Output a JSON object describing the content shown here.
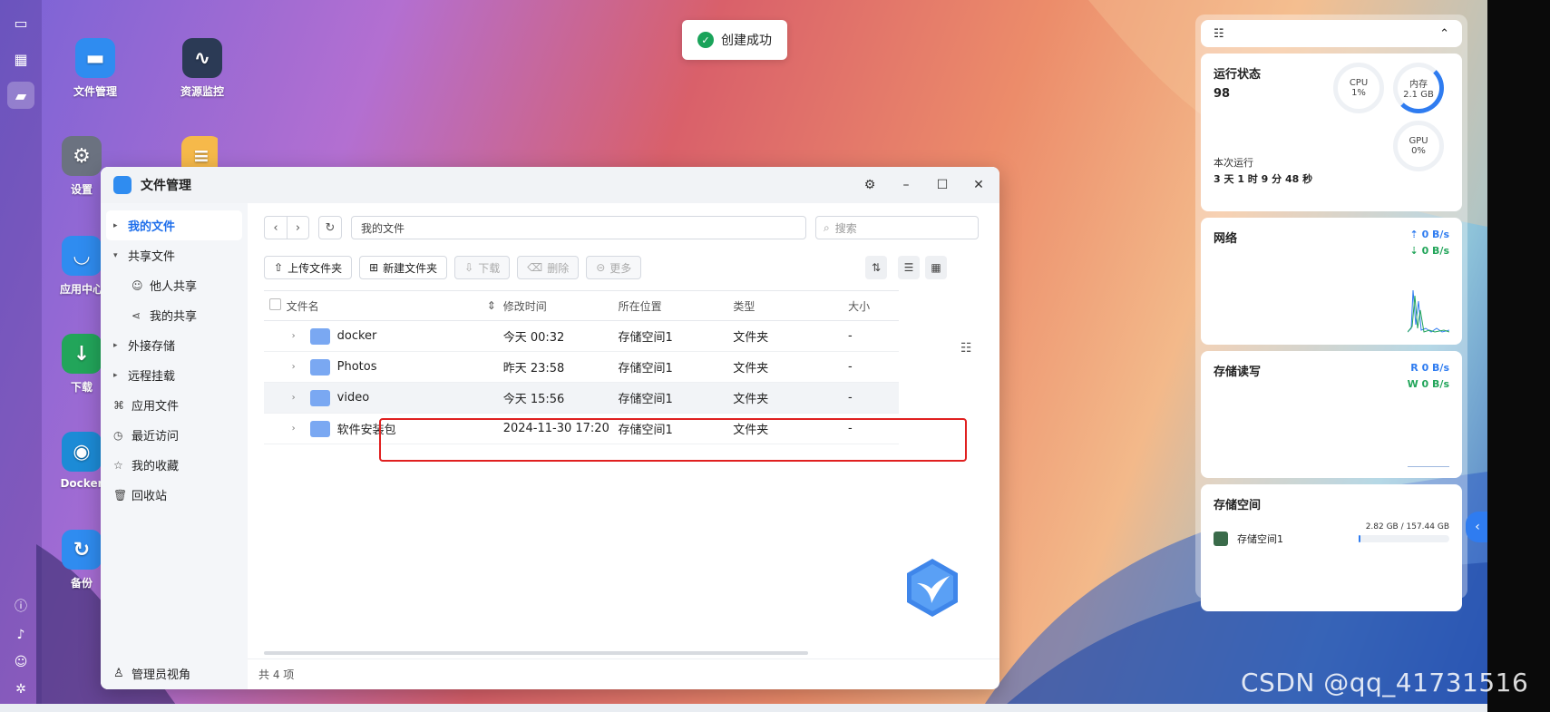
{
  "toast": {
    "text": "创建成功"
  },
  "desktop": {
    "icons": [
      {
        "label": "文件管理"
      },
      {
        "label": "资源监控"
      },
      {
        "label": "设置"
      },
      {
        "label": "应用中心"
      },
      {
        "label": "下载"
      },
      {
        "label": "Docker"
      },
      {
        "label": "备份"
      }
    ]
  },
  "window": {
    "title": "文件管理",
    "sidebar": {
      "items": [
        {
          "label": "我的文件"
        },
        {
          "label": "共享文件"
        },
        {
          "label": "他人共享"
        },
        {
          "label": "我的共享"
        },
        {
          "label": "外接存储"
        },
        {
          "label": "远程挂载"
        },
        {
          "label": "应用文件"
        },
        {
          "label": "最近访问"
        },
        {
          "label": "我的收藏"
        },
        {
          "label": "回收站"
        }
      ],
      "footer": "管理员视角"
    },
    "path": "我的文件",
    "search_placeholder": "搜索",
    "toolbar": {
      "upload": "上传文件夹",
      "new_folder": "新建文件夹",
      "download": "下载",
      "delete": "删除",
      "more": "更多"
    },
    "columns": {
      "name": "文件名",
      "modified": "修改时间",
      "location": "所在位置",
      "type": "类型",
      "size": "大小"
    },
    "rows": [
      {
        "name": "docker",
        "modified": "今天 00:32",
        "location": "存储空间1",
        "type": "文件夹",
        "size": "-"
      },
      {
        "name": "Photos",
        "modified": "昨天 23:58",
        "location": "存储空间1",
        "type": "文件夹",
        "size": "-"
      },
      {
        "name": "video",
        "modified": "今天 15:56",
        "location": "存储空间1",
        "type": "文件夹",
        "size": "-"
      },
      {
        "name": "软件安装包",
        "modified": "2024-11-30 17:20",
        "location": "存储空间1",
        "type": "文件夹",
        "size": "-"
      }
    ],
    "footer": "共 4 项"
  },
  "widgets": {
    "status": {
      "title": "运行状态",
      "value": "98",
      "cpu_label": "CPU",
      "cpu_value": "1%",
      "mem_label": "内存",
      "mem_value": "2.1 GB",
      "gpu_label": "GPU",
      "gpu_value": "0%",
      "uptime_label": "本次运行",
      "uptime_value": "3 天 1 时 9 分 48 秒"
    },
    "network": {
      "title": "网络",
      "up": "0 B/s",
      "down": "0 B/s"
    },
    "disk_io": {
      "title": "存储读写",
      "read": "R 0 B/s",
      "write": "W 0 B/s"
    },
    "storage": {
      "title": "存储空间",
      "name": "存储空间1",
      "usage": "2.82 GB / 157.44 GB",
      "used_fraction": 0.018
    }
  },
  "watermark": "CSDN @qq_41731516",
  "colors": {
    "accent": "#2f7cf0",
    "highlight_box": "#e02020",
    "success": "#1aa35a"
  }
}
